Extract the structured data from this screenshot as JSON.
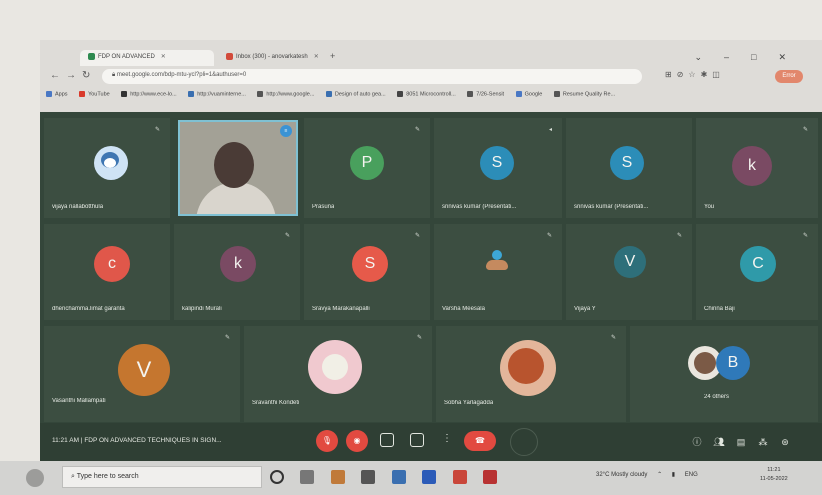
{
  "browser": {
    "tabs": [
      {
        "label": "FDP ON ADVANCED",
        "icon_color": "#2e8a50"
      },
      {
        "label": "Inbox (300) - anovarkatesh",
        "icon_color": "#d24a3a"
      }
    ],
    "url": "meet.google.com/bdp-mtu-ycl?pli=1&authuser=0",
    "profile_label": "Error",
    "bookmarks": [
      {
        "label": "Apps",
        "color": "#4a78c4"
      },
      {
        "label": "YouTube",
        "color": "#d93a2b"
      },
      {
        "label": "http://www.ece-lo...",
        "color": "#333333"
      },
      {
        "label": "http://vuaminterne...",
        "color": "#3a6fb0"
      },
      {
        "label": "http://www.google...",
        "color": "#555555"
      },
      {
        "label": "Design of auto gea...",
        "color": "#3a6fb0"
      },
      {
        "label": "8051 Microcontroll...",
        "color": "#444444"
      },
      {
        "label": "7/26-Sensit",
        "color": "#555555"
      },
      {
        "label": "Google",
        "color": "#4a78c4"
      },
      {
        "label": "Resume Quality Re...",
        "color": "#555555"
      }
    ]
  },
  "participants": [
    {
      "name": "vijaya nallabotthula",
      "initial": "",
      "color": "#cfe3f5"
    },
    {
      "name": "",
      "initial": "",
      "color": ""
    },
    {
      "name": "Prasuna",
      "initial": "P",
      "color": "#49a05d"
    },
    {
      "name": "srinivas kumar (Presentati...",
      "initial": "S",
      "color": "#2c8db8"
    },
    {
      "name": "srinivas kumar (Presentati...",
      "initial": "S",
      "color": "#2c8db8"
    },
    {
      "name": "You",
      "initial": "k",
      "color": "#7a4a63"
    },
    {
      "name": "dhenchamma.limat garanta",
      "initial": "c",
      "color": "#e0574a"
    },
    {
      "name": "kalipindi Murali",
      "initial": "k",
      "color": "#7a4a63"
    },
    {
      "name": "Sravya Marakanapalli",
      "initial": "S",
      "color": "#e65a4a"
    },
    {
      "name": "Varsha Meesala",
      "initial": "",
      "color": ""
    },
    {
      "name": "Vijaya Y",
      "initial": "V",
      "color": "#2e6f7a"
    },
    {
      "name": "Chinna Baji",
      "initial": "C",
      "color": "#2f9aa9"
    },
    {
      "name": "Vasanthi Mallampati",
      "initial": "V",
      "color": "#c5762f"
    },
    {
      "name": "Sravanthi Kondeti",
      "initial": "",
      "color": "#f0c9cf"
    },
    {
      "name": "Sobha Yarlagadda",
      "initial": "",
      "color": "#e3b69b"
    },
    {
      "name": "24 others",
      "initial": "B",
      "color": "#2f79b9"
    }
  ],
  "meeting": {
    "time": "11:21 AM",
    "separator": "|",
    "title": "FDP ON ADVANCED TECHNIQUES IN SIGN..."
  },
  "taskbar": {
    "search_placeholder": "Type here to search",
    "weather": "32°C  Mostly cloudy",
    "lang": "ENG",
    "time": "11:21",
    "date": "11-05-2022"
  }
}
